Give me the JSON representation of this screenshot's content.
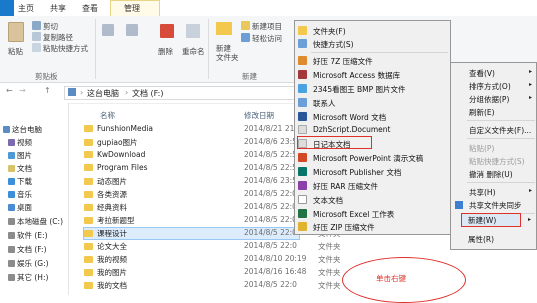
{
  "ribbon_tabs": [
    {
      "label": "主页"
    },
    {
      "label": "共享"
    },
    {
      "label": "查看"
    },
    {
      "label": "管理"
    }
  ],
  "ribbon": {
    "paste": "粘贴",
    "cut": "剪切",
    "copy_path": "复制路径",
    "paste_shortcut": "粘贴快捷方式",
    "clipboard_group": "剪贴板",
    "delete": "删除",
    "rename": "重命名",
    "new_folder": "新建\n文件夹",
    "new_item": "新建项目",
    "easy_access": "轻松访问",
    "new_group": "新建"
  },
  "address": {
    "path_root": "这台电脑",
    "path_leaf": "文档 (F:)"
  },
  "columns": {
    "name": "名称",
    "date": "修改日期"
  },
  "nav_items": [
    {
      "label": "这台电脑",
      "color": "#5b8cc4"
    },
    {
      "label": "视频",
      "color": "#7d6bb0"
    },
    {
      "label": "图片",
      "color": "#4f9ad6"
    },
    {
      "label": "文档",
      "color": "#d8c26a"
    },
    {
      "label": "下载",
      "color": "#3c8fd8"
    },
    {
      "label": "音乐",
      "color": "#3c8fd8"
    },
    {
      "label": "桌面",
      "color": "#4b8bd4"
    },
    {
      "label": "本地磁盘 (C:)",
      "color": "#8c8c8c"
    },
    {
      "label": "软件 (E:)",
      "color": "#8c8c8c"
    },
    {
      "label": "文档 (F:)",
      "color": "#8c8c8c"
    },
    {
      "label": "娱乐 (G:)",
      "color": "#8c8c8c"
    },
    {
      "label": "其它 (H:)",
      "color": "#8c8c8c"
    }
  ],
  "files": [
    {
      "name": "FunshionMedia",
      "date": "2014/8/21 21:5"
    },
    {
      "name": "gupiao图片",
      "date": "2014/8/6 23:5"
    },
    {
      "name": "KwDownload",
      "date": "2014/8/5 22:5"
    },
    {
      "name": "Program Files",
      "date": "2014/8/5 22:5"
    },
    {
      "name": "动态图片",
      "date": "2014/8/6 23:5"
    },
    {
      "name": "各类资源",
      "date": "2014/8/5 22:0"
    },
    {
      "name": "经典资料",
      "date": "2014/8/5 22:0"
    },
    {
      "name": "考拉新题型",
      "date": "2014/8/5 22:0"
    },
    {
      "name": "课程设计",
      "date": "2014/8/5 22:0",
      "selected": true
    },
    {
      "name": "论文大全",
      "date": "2014/8/5 22:0"
    },
    {
      "name": "我的视频",
      "date": "2014/8/10 20:19"
    },
    {
      "name": "我的图片",
      "date": "2014/8/16 16:48"
    },
    {
      "name": "我的文档",
      "date": "2014/8/5 22:0"
    }
  ],
  "file_type_label": "文件夹",
  "menu_new": [
    {
      "label": "文件夹(F)",
      "color": "#f2c94c"
    },
    {
      "label": "快捷方式(S)",
      "color": "#6a9fd8"
    },
    {
      "label": "好压 7Z 压缩文件",
      "color": "#e08a2e"
    },
    {
      "label": "Microsoft Access 数据库",
      "color": "#a4373a"
    },
    {
      "label": "2345看图王 BMP 图片文件",
      "color": "#4aa3e0"
    },
    {
      "label": "联系人",
      "color": "#6a9fd8"
    },
    {
      "label": "Microsoft Word 文档",
      "color": "#2b579a"
    },
    {
      "label": "DzhScript.Document",
      "color": "#dddddd"
    },
    {
      "label": "日记本文档",
      "color": "#dddddd"
    },
    {
      "label": "Microsoft PowerPoint 演示文稿",
      "color": "#d24726"
    },
    {
      "label": "Microsoft Publisher 文档",
      "color": "#077568"
    },
    {
      "label": "好压 RAR 压缩文件",
      "color": "#8c3fa8"
    },
    {
      "label": "文本文档",
      "color": "#ffffff"
    },
    {
      "label": "Microsoft Excel 工作表",
      "color": "#217346"
    },
    {
      "label": "好压 ZIP 压缩文件",
      "color": "#e0b42e"
    }
  ],
  "menu_context": [
    {
      "label": "查看(V)",
      "disabled": false
    },
    {
      "label": "排序方式(O)",
      "disabled": false
    },
    {
      "label": "分组依据(P)",
      "disabled": false
    },
    {
      "label": "刷新(E)",
      "disabled": false
    },
    {
      "label": "自定义文件夹(F)...",
      "disabled": false
    },
    {
      "label": "粘贴(P)",
      "disabled": true
    },
    {
      "label": "粘贴快捷方式(S)",
      "disabled": true
    },
    {
      "label": "撤消 删除(U)",
      "disabled": false
    },
    {
      "label": "共享(H)",
      "disabled": false
    },
    {
      "label": "共享文件夹同步",
      "disabled": false
    },
    {
      "label": "新建(W)",
      "disabled": false
    },
    {
      "label": "属性(R)",
      "disabled": false
    }
  ],
  "annotation": "单击右键"
}
